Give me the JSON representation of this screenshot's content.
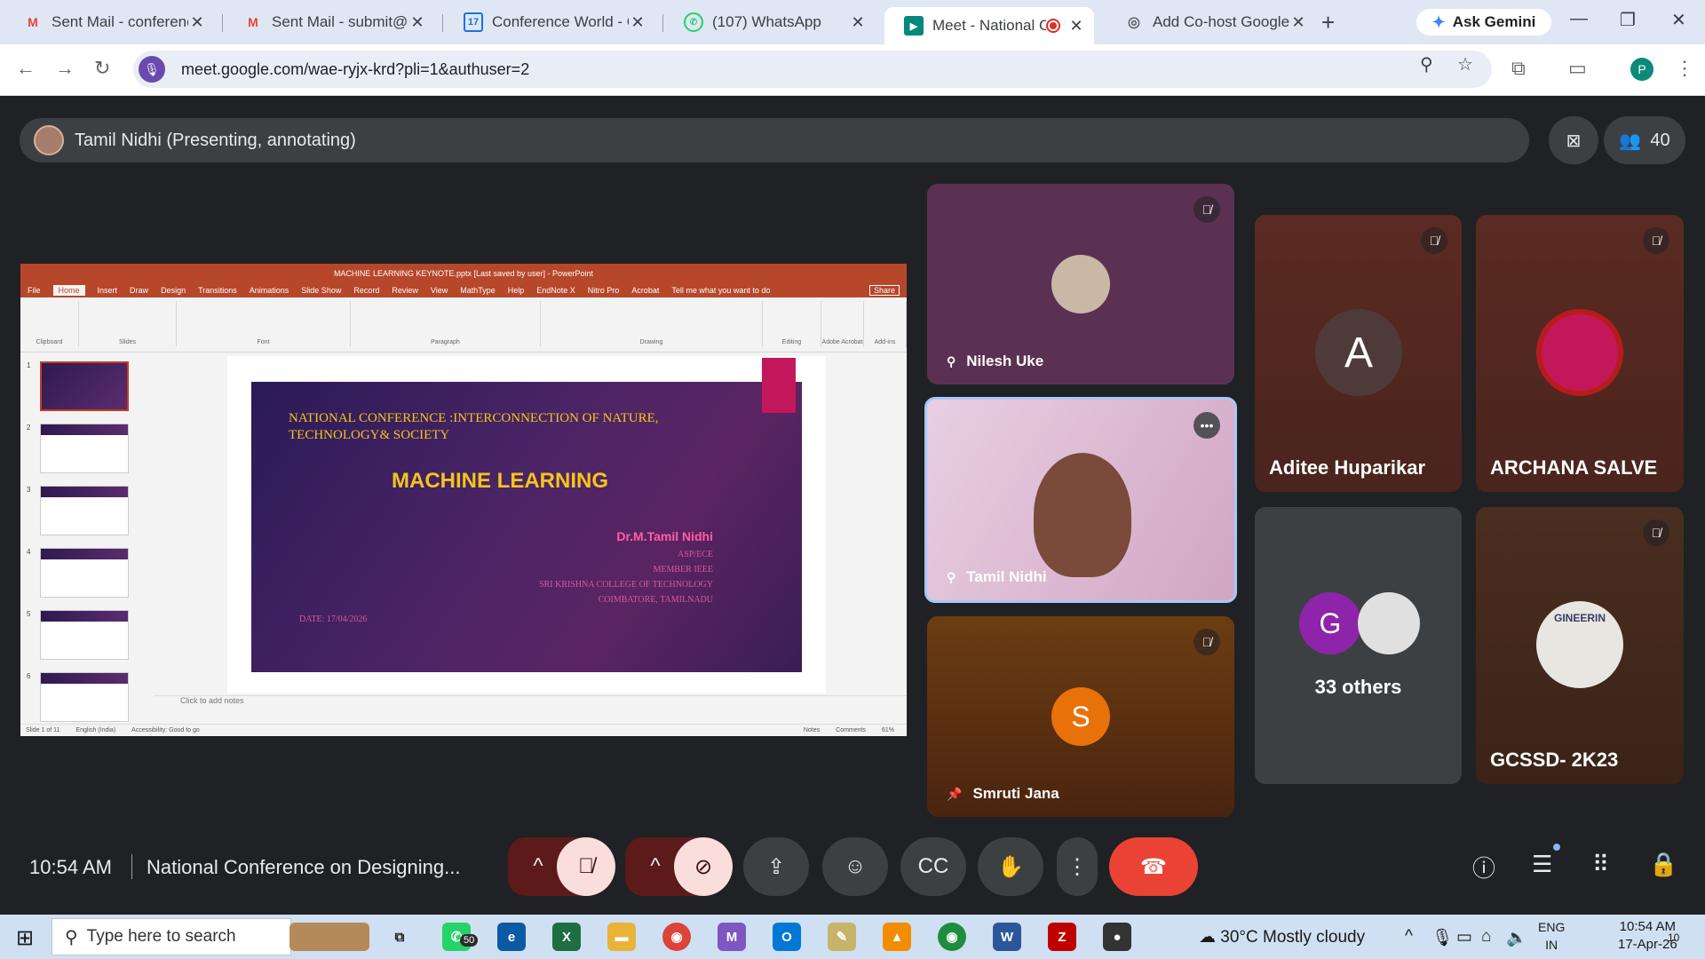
{
  "browser": {
    "tabs": [
      {
        "title": "Sent Mail - conference",
        "icon": "gmail-icon",
        "active": false
      },
      {
        "title": "Sent Mail - submit@co",
        "icon": "gmail-icon",
        "active": false
      },
      {
        "title": "Conference World - Ca",
        "icon": "calendar-icon",
        "active": false
      },
      {
        "title": "(107) WhatsApp",
        "icon": "whatsapp-icon",
        "active": false
      },
      {
        "title": "Meet - National Co",
        "icon": "meet-icon",
        "active": true
      },
      {
        "title": "Add Co-host Google M",
        "icon": "web-icon",
        "active": false
      }
    ],
    "gemini_label": "Ask Gemini",
    "url": "meet.google.com/wae-ryjx-krd?pli=1&authuser=2",
    "profile_initial": "P",
    "accent": "#1a73e8"
  },
  "meet": {
    "presenter_label": "Tamil Nidhi (Presenting, annotating)",
    "participant_count": "40",
    "time": "10:54 AM",
    "meeting_title": "National Conference on Designing...",
    "end_call_color": "#ea4335"
  },
  "presentation": {
    "ppt_title": "MACHINE LEARNING KEYNOTE.pptx [Last saved by user] - PowerPoint",
    "ribbon_tabs": [
      "File",
      "Home",
      "Insert",
      "Draw",
      "Design",
      "Transitions",
      "Animations",
      "Slide Show",
      "Record",
      "Review",
      "View",
      "MathType",
      "Help",
      "EndNote X",
      "Nitro Pro",
      "Acrobat",
      "Tell me what you want to do"
    ],
    "share_label": "Share",
    "ribbon_groups": [
      "Clipboard",
      "Slides",
      "Font",
      "Paragraph",
      "Drawing",
      "Editing",
      "Adobe Acrobat",
      "Add-ins"
    ],
    "thumb_numbers": [
      "1",
      "2",
      "3",
      "4",
      "5",
      "6"
    ],
    "notes_placeholder": "Click to add notes",
    "status_left": "Slide 1 of 11",
    "status_lang": "English (India)",
    "status_access": "Accessibility: Good to go",
    "status_notes": "Notes",
    "status_comments": "Comments",
    "zoom": "61%",
    "slide": {
      "heading_line1": "NATIONAL CONFERENCE :INTERCONNECTION OF NATURE,",
      "heading_line2": "TECHNOLOGY& SOCIETY",
      "title": "MACHINE LEARNING",
      "author": "Dr.M.Tamil Nidhi",
      "line1": "ASP/ECE",
      "line2": "MEMBER IEEE",
      "line3": "SRI KRISHNA COLLEGE OF TECHNOLOGY",
      "line4": "COIMBATORE, TAMILNADU",
      "date": "DATE: 17/04/2026"
    }
  },
  "participants": [
    {
      "name": "Nilesh Uke",
      "muted": true
    },
    {
      "name": "Tamil Nidhi",
      "muted": false
    },
    {
      "name": "Smruti Jana",
      "muted": true,
      "initial": "S",
      "avatar_color": "#e8710a"
    },
    {
      "name": "Aditee Huparikar",
      "muted": true,
      "initial": "A",
      "avatar_color": "#4e3b39"
    },
    {
      "name": "ARCHANA SALVE",
      "muted": true
    },
    {
      "name": "33 others",
      "initial": "G",
      "avatar_color": "#8e24aa"
    },
    {
      "name": "GCSSD- 2K23",
      "muted": true,
      "logo_text": "GINEERIN"
    }
  ],
  "taskbar": {
    "search_placeholder": "Type here to search",
    "whatsapp_badge": "50",
    "weather": "30°C  Mostly cloudy",
    "lang_line1": "ENG",
    "lang_line2": "IN",
    "time": "10:54 AM",
    "date": "17-Apr-26",
    "notif_count": "10"
  }
}
